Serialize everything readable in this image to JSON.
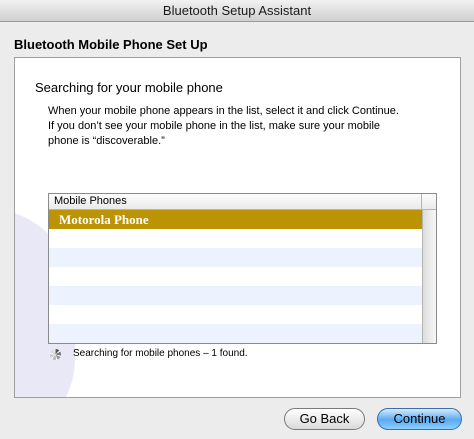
{
  "window": {
    "title": "Bluetooth Setup Assistant"
  },
  "pane": {
    "heading": "Bluetooth Mobile Phone Set Up"
  },
  "section": {
    "title": "Searching for your mobile phone",
    "description": [
      "When your mobile phone appears in the list, select it and click Continue.",
      "If you don’t see your mobile phone in the list, make sure your mobile",
      "phone is “discoverable.”"
    ]
  },
  "device_list": {
    "header": "Mobile Phones",
    "items": [
      "Motorola Phone"
    ],
    "selected_index": 0,
    "selection_color": "#bb9303"
  },
  "status": {
    "text": "Searching for mobile phones – 1 found."
  },
  "buttons": {
    "back": "Go Back",
    "continue": "Continue"
  },
  "colors": {
    "default_button": "#5aa9f0",
    "alternate_row": "#edf3fe"
  }
}
